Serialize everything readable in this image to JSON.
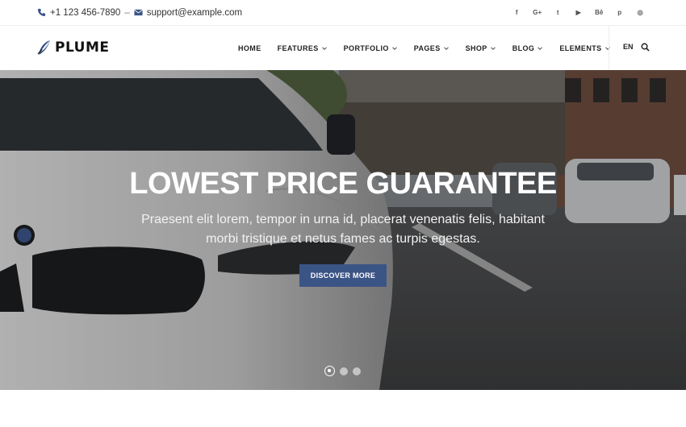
{
  "topbar": {
    "phone": "+1 123 456-7890",
    "separator": "–",
    "email": "support@example.com",
    "social": [
      "f",
      "G+",
      "t",
      "▶",
      "Bē",
      "p",
      "◎"
    ]
  },
  "header": {
    "logo_text": "PLUME",
    "nav": [
      {
        "label": "HOME",
        "dropdown": false
      },
      {
        "label": "FEATURES",
        "dropdown": true
      },
      {
        "label": "PORTFOLIO",
        "dropdown": true
      },
      {
        "label": "PAGES",
        "dropdown": true
      },
      {
        "label": "SHOP",
        "dropdown": true
      },
      {
        "label": "BLOG",
        "dropdown": true
      },
      {
        "label": "ELEMENTS",
        "dropdown": true
      }
    ],
    "lang": "EN"
  },
  "hero": {
    "title": "LOWEST PRICE GUARANTEE",
    "subtitle": "Praesent elit lorem, tempor in urna id, placerat venenatis felis, habitant morbi tristique et netus fames ac turpis egestas.",
    "cta": "DISCOVER MORE",
    "slides": 3,
    "active_slide": 1
  },
  "colors": {
    "accent": "#3b5486",
    "text": "#222222"
  }
}
